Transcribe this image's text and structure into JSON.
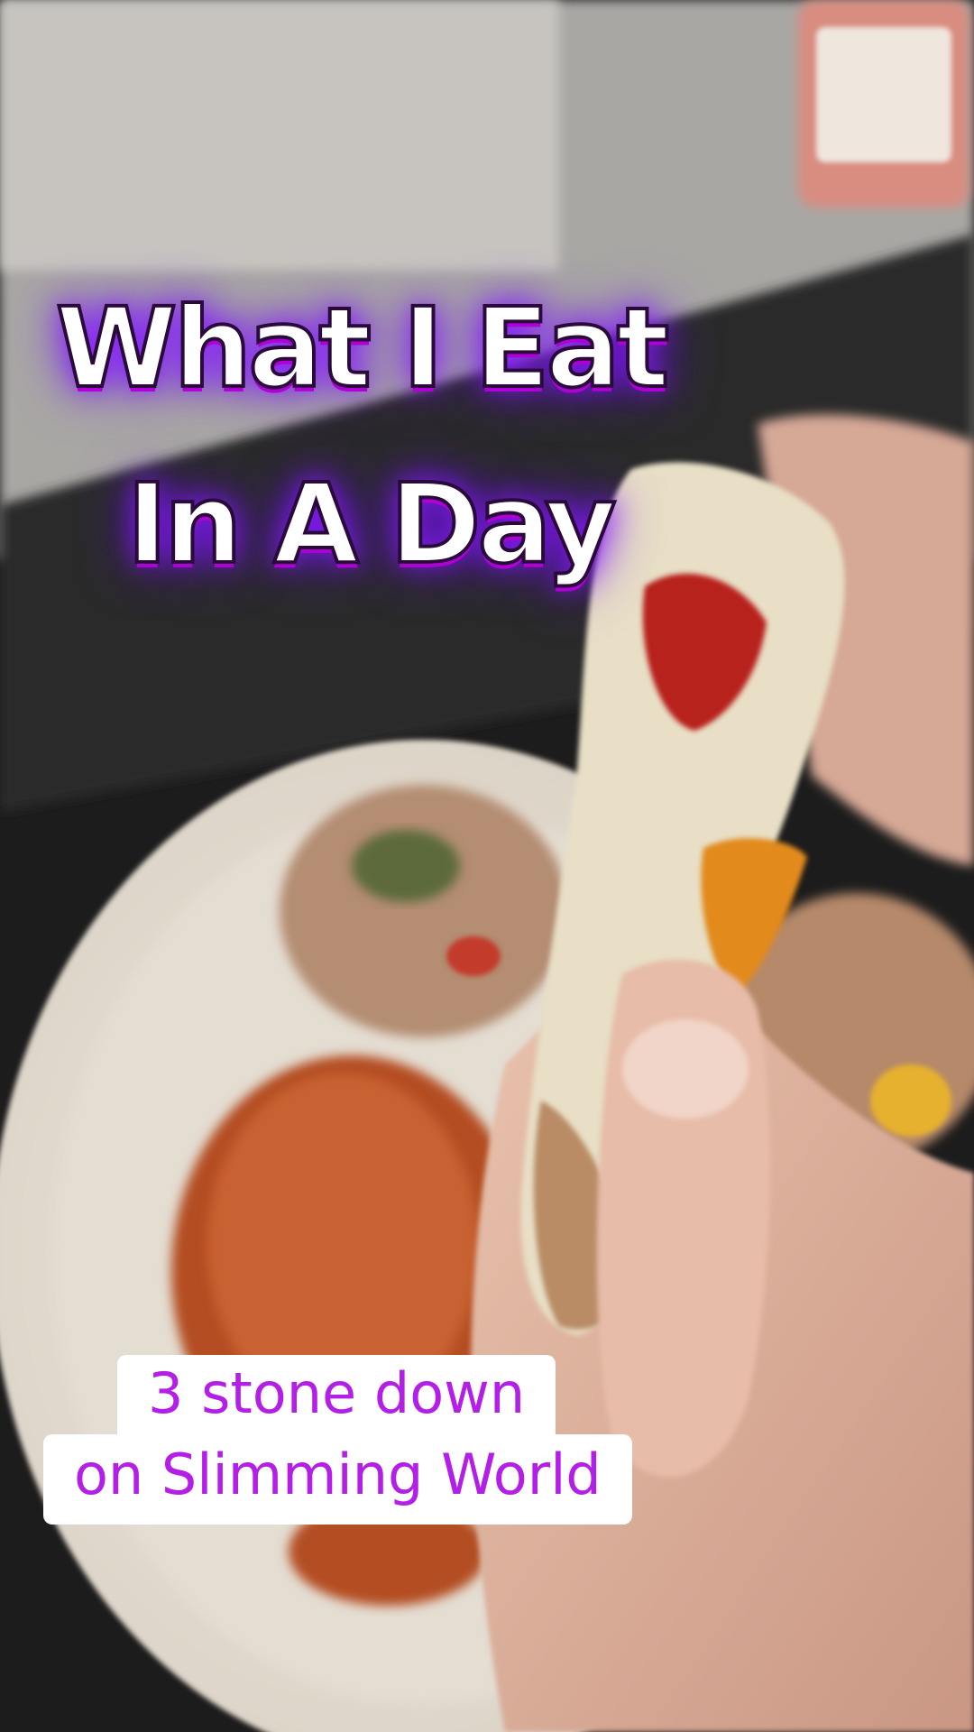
{
  "overlay": {
    "title_line1": "What I Eat",
    "title_line2": "In A Day",
    "caption_line1": "3 stone down",
    "caption_line2": "on Slimming World"
  },
  "colors": {
    "title_glow": "#8a1cff",
    "caption_text": "#b31fe6",
    "caption_bg": "#ffffff"
  }
}
